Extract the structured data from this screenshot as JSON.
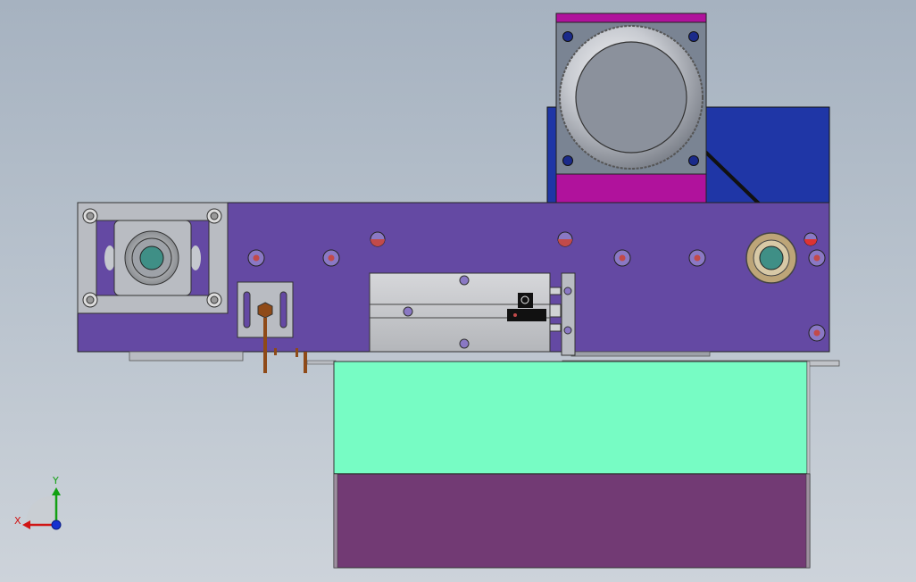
{
  "view": {
    "title": "",
    "triad": {
      "x_label": "X",
      "y_label": "Y"
    }
  },
  "colors": {
    "background_top": "#a6b2c0",
    "background_bottom": "#cdd3da",
    "main_plate": "#6449a3",
    "motor_body": "#b0129c",
    "motor_frame": "#7a8493",
    "motor_knob": "#8b919c",
    "blue_bracket": "#1f36a6",
    "cyan_tank": "#77fcc4",
    "purple_base": "#723a74",
    "cylinder": "#c9cacd",
    "bearing_ring": "#bda578",
    "bearing_center": "#3f8f86",
    "bolt_red": "#c24a4a",
    "copper": "#8f4a18",
    "axis_x": "#d01515",
    "axis_y": "#12a012",
    "axis_z": "#1530d0"
  },
  "parts": [
    {
      "name": "stepper-motor",
      "label": ""
    },
    {
      "name": "blue-bracket",
      "label": ""
    },
    {
      "name": "main-plate",
      "label": ""
    },
    {
      "name": "left-bearing-block",
      "label": ""
    },
    {
      "name": "right-bearing",
      "label": ""
    },
    {
      "name": "air-cylinder",
      "label": ""
    },
    {
      "name": "sensor-bracket",
      "label": ""
    },
    {
      "name": "cyan-tank",
      "label": ""
    },
    {
      "name": "purple-base",
      "label": ""
    }
  ]
}
